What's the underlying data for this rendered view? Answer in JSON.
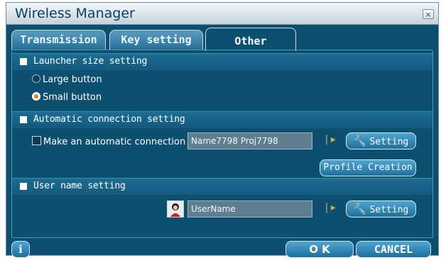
{
  "window": {
    "title": "Wireless Manager",
    "close_glyph": "×"
  },
  "tabs": [
    {
      "label": "Transmission",
      "active": false
    },
    {
      "label": "Key setting",
      "active": false
    },
    {
      "label": "Other",
      "active": true
    }
  ],
  "launcher": {
    "header": "Launcher size setting",
    "options": [
      {
        "label": "Large button",
        "selected": false
      },
      {
        "label": "Small button",
        "selected": true
      }
    ]
  },
  "auto_connect": {
    "header": "Automatic connection setting",
    "checkbox_label": "Make an automatic connection",
    "checked": false,
    "profile_value": "Name7798 Proj7798",
    "setting_label": "Setting",
    "profile_creation_label": "Profile Creation"
  },
  "user_name": {
    "header": "User name setting",
    "value": "UserName",
    "setting_label": "Setting"
  },
  "footer": {
    "info_label": "i",
    "ok_label": "O K",
    "cancel_label": "CANCEL"
  },
  "icons": {
    "wrench": "wrench-icon",
    "separator": "arrow-separator-icon",
    "avatar": "user-avatar-icon"
  },
  "colors": {
    "panel_bg": "#0d4f6f",
    "section_header": "#1c6c92",
    "button": "#2f86b5",
    "selected_radio_dot": "#e1841f",
    "title_text": "#0d3f62"
  }
}
